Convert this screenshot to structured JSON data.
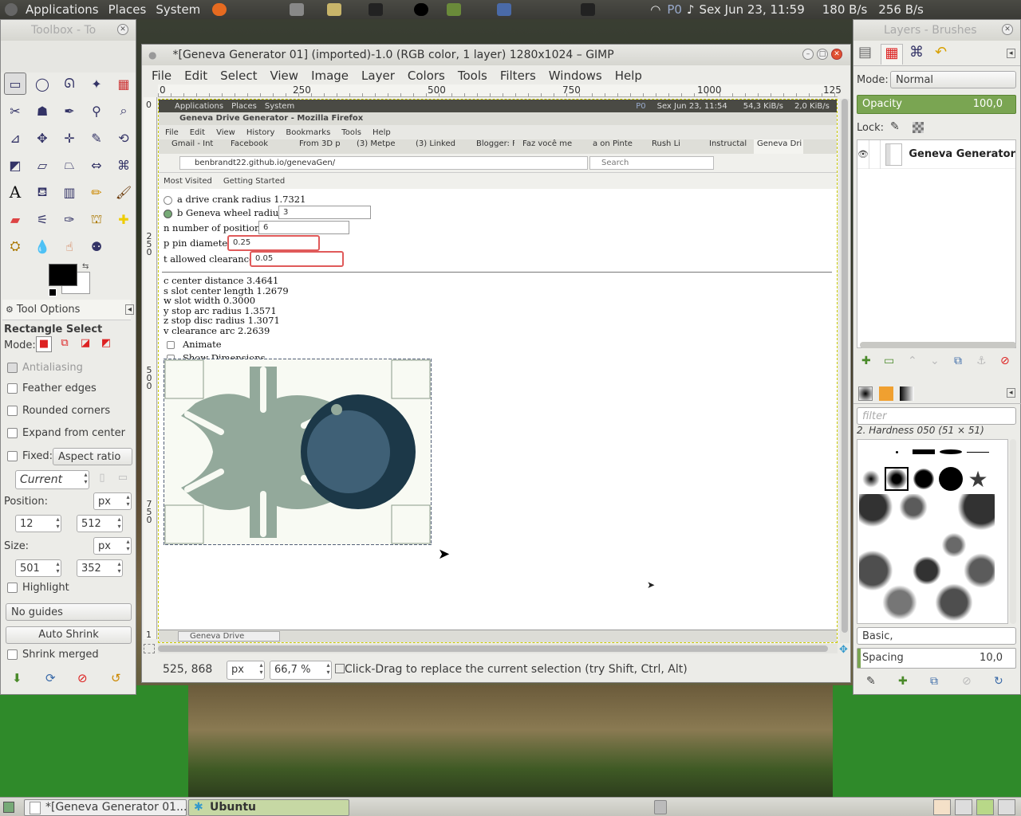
{
  "topbar": {
    "menus": [
      "Applications",
      "Places",
      "System"
    ],
    "status": "P0",
    "clock": "Sex Jun 23, 11:59",
    "net_down": "180 B/s",
    "net_up": "256 B/s"
  },
  "toolbox": {
    "title": "Toolbox - To",
    "tool_options_tab": "Tool Options",
    "tool_name": "Rectangle Select",
    "mode_label": "Mode:",
    "antialiasing": "Antialiasing",
    "feather": "Feather edges",
    "rounded": "Rounded corners",
    "expand": "Expand from center",
    "fixed": "Fixed:",
    "fixed_value": "Aspect ratio",
    "current": "Current",
    "position_label": "Position:",
    "position_unit": "px",
    "pos_x": "12",
    "pos_y": "512",
    "size_label": "Size:",
    "size_unit": "px",
    "size_w": "501",
    "size_h": "352",
    "highlight": "Highlight",
    "guides": "No guides",
    "auto_shrink": "Auto Shrink",
    "shrink_merged": "Shrink merged"
  },
  "gimp": {
    "title": "*[Geneva Generator 01] (imported)-1.0 (RGB color, 1 layer) 1280x1024 – GIMP",
    "menu": [
      "File",
      "Edit",
      "Select",
      "View",
      "Image",
      "Layer",
      "Colors",
      "Tools",
      "Filters",
      "Windows",
      "Help"
    ],
    "ruler_marks": [
      "0",
      "250",
      "500",
      "750",
      "1000",
      "125"
    ],
    "status": {
      "coords": "525, 868",
      "unit": "px",
      "zoom": "66,7 %",
      "hint": "Click-Drag to replace the current selection (try Shift, Ctrl, Alt)"
    }
  },
  "inner": {
    "topbar": [
      "Applications",
      "Places",
      "System"
    ],
    "topbar_status": "P0",
    "clock": "Sex Jun 23, 11:54",
    "net": "54,3 KiB/s",
    "net2": "2,0 KiB/s",
    "ff_title": "Geneva Drive Generator - Mozilla Firefox",
    "ff_menu": [
      "File",
      "Edit",
      "View",
      "History",
      "Bookmarks",
      "Tools",
      "Help"
    ],
    "tabs": [
      "Gmail - Int",
      "Facebook",
      "From 3D p",
      "(3) Metpe",
      "(3) Linked",
      "Blogger: F",
      "Faz você mes",
      "a on Pinte",
      "Rush Li",
      "Instructal",
      "Geneva Dri"
    ],
    "url": "benbrandt22.github.io/genevaGen/",
    "search": "Search",
    "bookmarks": [
      "Most Visited",
      "Getting Started"
    ],
    "form": {
      "a": "a drive crank radius 1.7321",
      "b": "b Geneva wheel radius",
      "b_val": "3",
      "n": "n number of positions",
      "n_val": "6",
      "p": "p pin diameter",
      "p_val": "0.25",
      "t": "t allowed clearance",
      "t_val": "0.05"
    },
    "results": [
      "c center distance 3.4641",
      "s slot center length 1.2679",
      "w slot width 0.3000",
      "y stop arc radius 1.3571",
      "z stop disc radius 1.3071",
      "v clearance arc 2.2639"
    ],
    "animate": "Animate",
    "show_dim": "Show Dimensions",
    "taskbar": "Geneva Drive Generat...",
    "left_ruler": [
      "2",
      "5",
      "0",
      "5",
      "0",
      "0",
      "7",
      "5",
      "0",
      "1"
    ]
  },
  "layers": {
    "title": "Layers - Brushes",
    "mode_label": "Mode:",
    "mode": "Normal",
    "opacity_label": "Opacity",
    "opacity": "100,0",
    "lock_label": "Lock:",
    "layer_name": "Geneva Generator",
    "filter_placeholder": "filter",
    "brush_name": "2. Hardness 050 (51 × 51)",
    "preset": "Basic,",
    "spacing_label": "Spacing",
    "spacing": "10,0"
  },
  "taskbar": {
    "gimp": "*[Geneva Generator 01...",
    "ubuntu": "Ubuntu"
  },
  "colors": {
    "accent": "#7aa552",
    "chart_wheel": "#93a99b",
    "chart_crank": "#1c3848",
    "chart_bg": "#f8faf3"
  }
}
